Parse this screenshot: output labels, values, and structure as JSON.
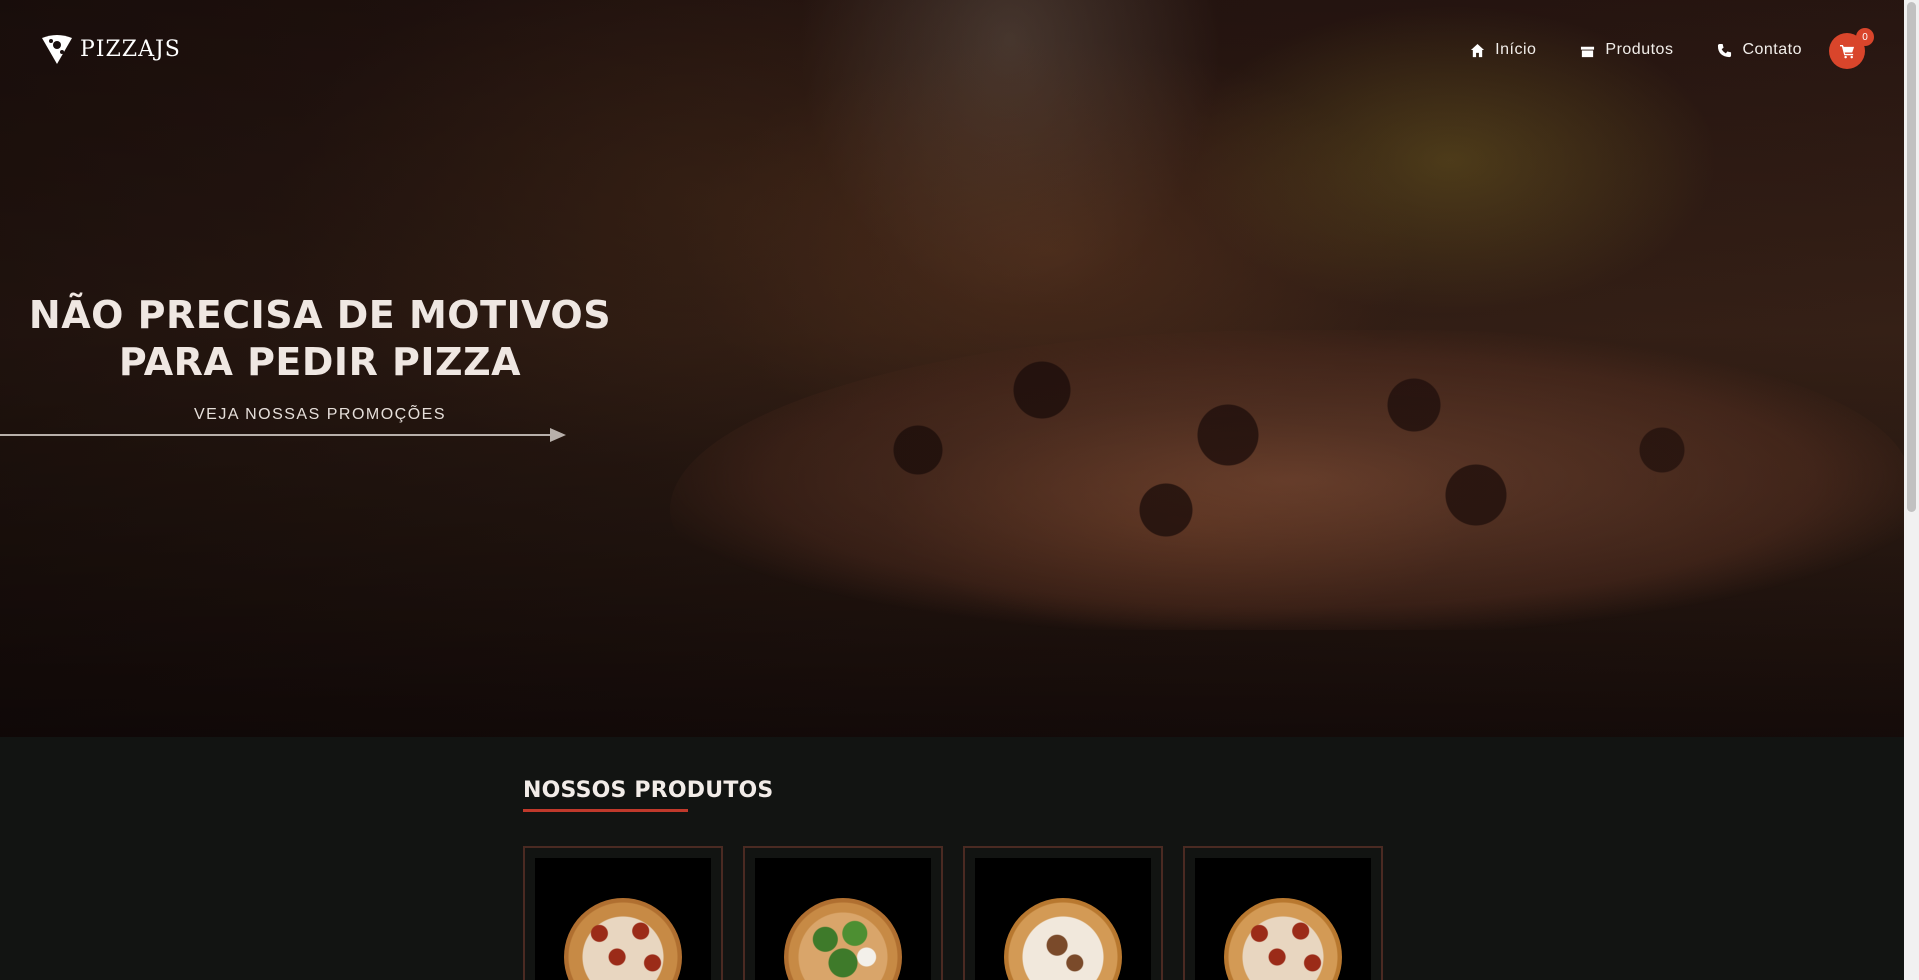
{
  "brand": {
    "name": "PIZZAJS"
  },
  "nav": {
    "items": [
      {
        "label": "Início",
        "icon": "home-icon"
      },
      {
        "label": "Produtos",
        "icon": "box-icon"
      },
      {
        "label": "Contato",
        "icon": "phone-icon"
      }
    ],
    "cart": {
      "icon": "cart-icon",
      "count": "0"
    }
  },
  "hero": {
    "title_line1": "NÃO PRECISA DE MOTIVOS",
    "title_line2": "PARA PEDIR PIZZA",
    "promo_link": "VEJA NOSSAS PROMOÇÕES"
  },
  "products": {
    "section_title": "NOSSOS PRODUTOS",
    "items": [
      {
        "image": "pizza-pepperoni-onion"
      },
      {
        "image": "pizza-arugula"
      },
      {
        "image": "pizza-white-cheese"
      },
      {
        "image": "pizza-pepperoni-onion"
      }
    ]
  },
  "colors": {
    "accent": "#d9452b",
    "background": "#121412",
    "card_border": "#4a2a22"
  }
}
